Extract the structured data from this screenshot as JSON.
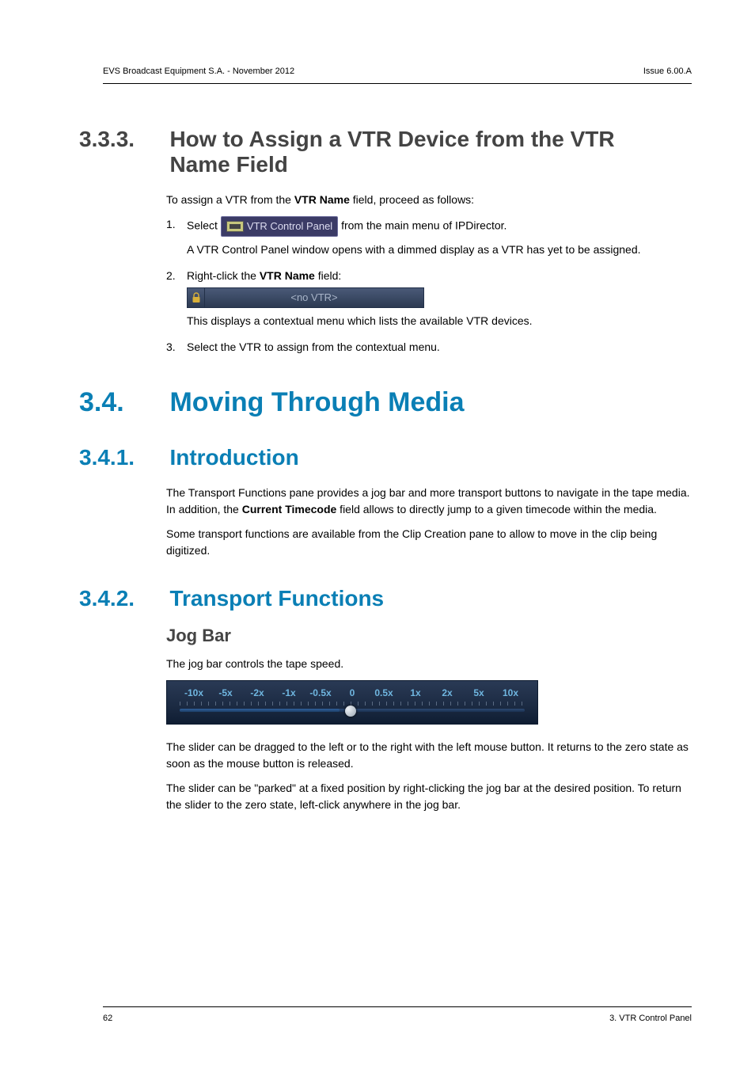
{
  "header": {
    "left": "EVS Broadcast Equipment S.A.  - November 2012",
    "right": "Issue 6.00.A"
  },
  "footer": {
    "left": "62",
    "right": "3. VTR Control Panel"
  },
  "s333": {
    "num": "3.3.3.",
    "title": "How to Assign a VTR Device from the VTR Name Field",
    "intro_pre": "To assign a VTR from the ",
    "intro_bold": "VTR Name",
    "intro_post": " field, proceed as follows:",
    "step1_pre": "Select ",
    "step1_button": "VTR Control Panel",
    "step1_post": " from the main menu of IPDirector.",
    "step1_para": "A VTR Control Panel window opens with a dimmed display as a VTR has yet to be assigned.",
    "step2_pre": "Right-click the ",
    "step2_bold": "VTR Name",
    "step2_post": " field:",
    "step2_bar_label": "<no VTR>",
    "step2_para": "This displays a contextual menu which lists the available VTR devices.",
    "step3": "Select the VTR to assign from the contextual menu."
  },
  "s34": {
    "num": "3.4.",
    "title": "Moving Through Media"
  },
  "s341": {
    "num": "3.4.1.",
    "title": "Introduction",
    "p1_pre": "The Transport Functions pane provides a jog bar and more transport buttons to navigate in the tape media. In addition, the ",
    "p1_bold": "Current Timecode",
    "p1_post": " field allows to directly jump to a given timecode within the media.",
    "p2": "Some transport functions are available from the Clip Creation pane to allow to move in the clip being digitized."
  },
  "s342": {
    "num": "3.4.2.",
    "title": "Transport Functions",
    "sub": "Jog Bar",
    "p1": "The jog bar controls the tape speed.",
    "labels": [
      "-10x",
      "-5x",
      "-2x",
      "-1x",
      "-0.5x",
      "0",
      "0.5x",
      "1x",
      "2x",
      "5x",
      "10x"
    ],
    "p2": "The slider can be dragged to the left or to the right with the left mouse button.  It returns to the zero state as soon as the mouse button is released.",
    "p3": "The slider can be \"parked\" at a fixed position by right-clicking the jog bar at the desired position. To return the slider to the zero state, left-click anywhere in the jog bar."
  }
}
